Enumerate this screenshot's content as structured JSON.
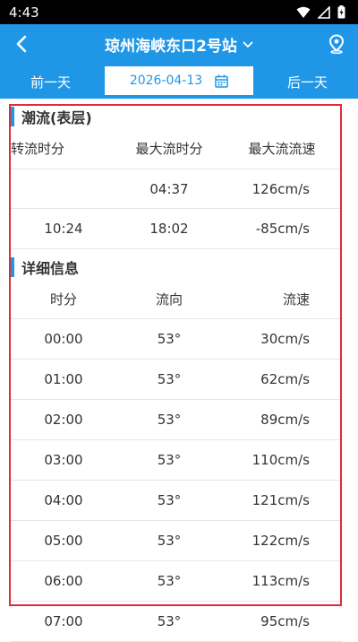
{
  "status": {
    "time": "4:43"
  },
  "header": {
    "title": "琼州海峡东口2号站"
  },
  "datebar": {
    "prev": "前一天",
    "date": "2026-04-13",
    "next": "后一天"
  },
  "tide": {
    "title": "潮流(表层)",
    "headers": [
      "转流时分",
      "最大流时分",
      "最大流流速"
    ],
    "rows": [
      [
        "",
        "04:37",
        "126cm/s"
      ],
      [
        "10:24",
        "18:02",
        "-85cm/s"
      ]
    ]
  },
  "detail": {
    "title": "详细信息",
    "headers": [
      "时分",
      "流向",
      "流速"
    ],
    "rows": [
      [
        "00:00",
        "53°",
        "30cm/s"
      ],
      [
        "01:00",
        "53°",
        "62cm/s"
      ],
      [
        "02:00",
        "53°",
        "89cm/s"
      ],
      [
        "03:00",
        "53°",
        "110cm/s"
      ],
      [
        "04:00",
        "53°",
        "121cm/s"
      ],
      [
        "05:00",
        "53°",
        "122cm/s"
      ],
      [
        "06:00",
        "53°",
        "113cm/s"
      ],
      [
        "07:00",
        "53°",
        "95cm/s"
      ]
    ]
  },
  "colors": {
    "primary": "#1f97e6",
    "highlight": "#e02b3a"
  }
}
